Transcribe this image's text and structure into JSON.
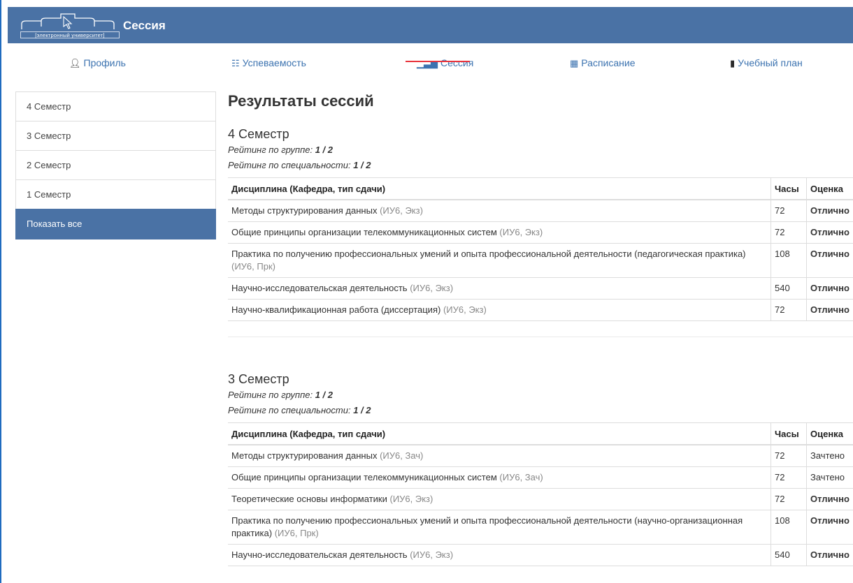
{
  "app": {
    "title": "Сессия",
    "logo_caption": "[электронный университет]"
  },
  "nav": [
    {
      "label": "Профиль",
      "icon": "user-icon"
    },
    {
      "label": "Успеваемость",
      "icon": "grid-icon"
    },
    {
      "label": "Сессия",
      "icon": "bar-chart-icon"
    },
    {
      "label": "Расписание",
      "icon": "calendar-icon"
    },
    {
      "label": "Учебный план",
      "icon": "book-icon"
    }
  ],
  "sidebar": {
    "items": [
      "4 Семестр",
      "3 Семестр",
      "2 Семестр",
      "1 Семестр"
    ],
    "show_all": "Показать все"
  },
  "page_title": "Результаты сессий",
  "table_headers": {
    "discipline": "Дисциплина (Кафедра, тип сдачи)",
    "hours": "Часы",
    "grade": "Оценка"
  },
  "semesters": [
    {
      "title": "4 Семестр",
      "rating_group_label": "Рейтинг по группе:",
      "rating_group_value": "1 / 2",
      "rating_spec_label": "Рейтинг по специальности:",
      "rating_spec_value": "1 / 2",
      "rows": [
        {
          "name": "Методы структурирования данных",
          "dept": "(ИУ6, Экз)",
          "hours": "72",
          "grade": "Отлично"
        },
        {
          "name": "Общие принципы организации телекоммуникационных систем",
          "dept": "(ИУ6, Экз)",
          "hours": "72",
          "grade": "Отлично"
        },
        {
          "name": "Практика по получению профессиональных умений и опыта профессиональной деятельности (педагогическая практика)",
          "dept": "(ИУ6, Прк)",
          "hours": "108",
          "grade": "Отлично"
        },
        {
          "name": "Научно-исследовательская деятельность",
          "dept": "(ИУ6, Экз)",
          "hours": "540",
          "grade": "Отлично"
        },
        {
          "name": "Научно-квалификационная работа (диссертация)",
          "dept": "(ИУ6, Экз)",
          "hours": "72",
          "grade": "Отлично"
        }
      ]
    },
    {
      "title": "3 Семестр",
      "rating_group_label": "Рейтинг по группе:",
      "rating_group_value": "1 / 2",
      "rating_spec_label": "Рейтинг по специальности:",
      "rating_spec_value": "1 / 2",
      "rows": [
        {
          "name": "Методы структурирования данных",
          "dept": "(ИУ6, Зач)",
          "hours": "72",
          "grade": "Зачтено"
        },
        {
          "name": "Общие принципы организации телекоммуникационных систем",
          "dept": "(ИУ6, Зач)",
          "hours": "72",
          "grade": "Зачтено"
        },
        {
          "name": "Теоретические основы информатики",
          "dept": "(ИУ6, Экз)",
          "hours": "72",
          "grade": "Отлично"
        },
        {
          "name": "Практика по получению профессиональных умений и опыта профессиональной деятельности (научно-организационная практика)",
          "dept": "(ИУ6, Прк)",
          "hours": "108",
          "grade": "Отлично"
        },
        {
          "name": "Научно-исследовательская деятельность",
          "dept": "(ИУ6, Экз)",
          "hours": "540",
          "grade": "Отлично"
        }
      ]
    }
  ],
  "colors": {
    "header_bg": "#4a72a5",
    "link": "#3c73b0",
    "grade_green": "#3a8f3a",
    "nav_strike": "#e8333c"
  }
}
